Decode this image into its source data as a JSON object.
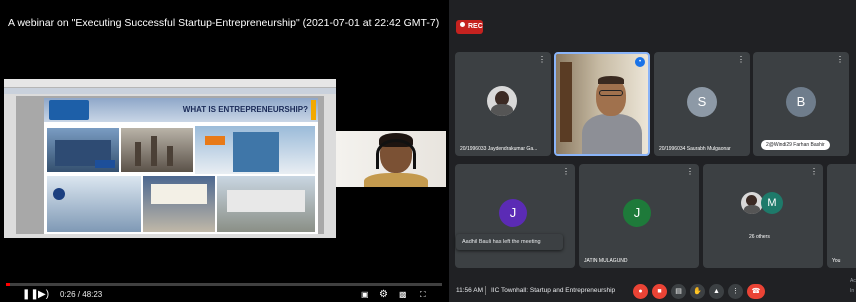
{
  "video": {
    "title": "A webinar on \"Executing Successful Startup-Entrepreneurship\" (2021-07-01 at 22:42 GMT-7)",
    "slide": {
      "heading": "WHAT IS ENTREPRENEURSHIP?",
      "logo_text": "Sindicators",
      "tata_label": "TATA",
      "reliance_label_1": "Reliance",
      "reliance_label_2": "Reliance"
    },
    "time_display": "0:26 / 48:23",
    "progress_fraction": 0.009
  },
  "meeting": {
    "rec_label": "REC",
    "tiles": [
      {
        "name": "20/1996033 Jaydendrakumar Ga...",
        "type": "photo"
      },
      {
        "name": "",
        "type": "speaker"
      },
      {
        "name": "20/1996034 Saurabh Mulgaonar",
        "type": "avatar",
        "initial": "S",
        "color": "#8d99a6"
      },
      {
        "name": "2@Windi29 Farhan Bashir",
        "type": "avatar",
        "initial": "B",
        "color": "#6f7d8c"
      },
      {
        "name": "",
        "type": "avatar",
        "initial": "J",
        "color": "#5b2bb5"
      },
      {
        "name": "JATIN MULAGUND",
        "type": "avatar",
        "initial": "J",
        "color": "#1e7a3a"
      },
      {
        "name": "26 others",
        "type": "group",
        "initial": "M",
        "color": "#1e7a6a"
      },
      {
        "name": "You",
        "type": "self"
      }
    ],
    "toast_text": "Aadhil Bauli has left the meeting",
    "clock": "11:56 AM",
    "meeting_title": "IIC Townhall: Startup and Entrepreneurship",
    "edge_text_1": "Ac",
    "edge_text_2": "In"
  },
  "colors": {
    "progress": "#ff0000",
    "rec": "#c5221f",
    "end_call": "#ea4335",
    "active_border": "#8ab4f8"
  },
  "icons": {
    "player": [
      "pause-icon",
      "next-icon",
      "volume-icon",
      "subtitles-icon",
      "settings-icon",
      "miniplayer-icon",
      "fullscreen-icon"
    ],
    "meet": [
      "mic-off-icon",
      "camera-off-icon",
      "captions-icon",
      "raise-hand-icon",
      "present-icon",
      "more-icon",
      "end-call-icon"
    ]
  }
}
